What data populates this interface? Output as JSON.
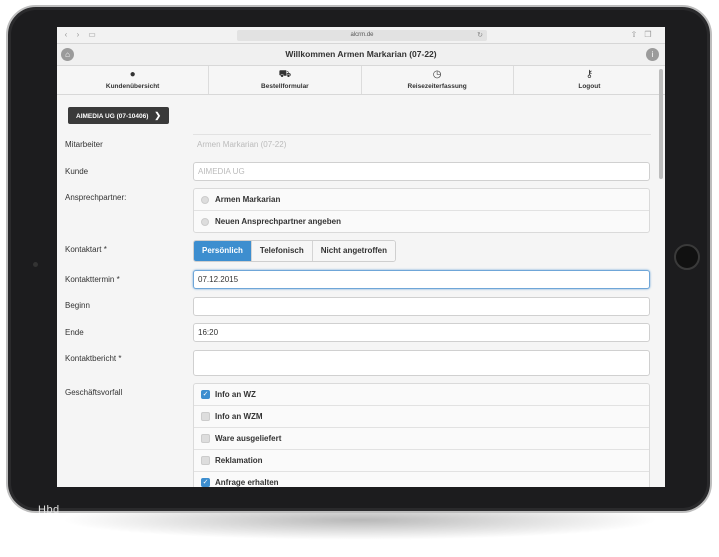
{
  "browser": {
    "url": "alcrm.de",
    "reload_icon": "reload-icon",
    "share_icon": "share-icon",
    "tabs_icon": "tabs-icon"
  },
  "header": {
    "title": "Willkommen Armen Markarian (07-22)",
    "home_icon": "home-icon",
    "info_icon": "info-icon"
  },
  "nav": {
    "items": [
      {
        "label": "Kundenübersicht",
        "icon": "user-icon"
      },
      {
        "label": "Bestellformular",
        "icon": "cart-icon"
      },
      {
        "label": "Reisezeiterfassung",
        "icon": "clock-icon"
      },
      {
        "label": "Logout",
        "icon": "key-icon"
      }
    ]
  },
  "company_button": {
    "label": "AIMEDIA UG (07-10406)"
  },
  "form": {
    "mitarbeiter": {
      "label": "Mitarbeiter",
      "value": "Armen Markarian (07-22)"
    },
    "kunde": {
      "label": "Kunde",
      "value": "AIMEDIA UG"
    },
    "ansprechpartner": {
      "label": "Ansprechpartner:",
      "options": [
        "Armen Markarian",
        "Neuen Ansprechpartner angeben"
      ]
    },
    "kontaktart": {
      "label": "Kontaktart *",
      "options": [
        "Persönlich",
        "Telefonisch",
        "Nicht angetroffen"
      ],
      "selected": "Persönlich"
    },
    "kontakttermin": {
      "label": "Kontakttermin *",
      "value": "07.12.2015"
    },
    "beginn": {
      "label": "Beginn",
      "value": ""
    },
    "ende": {
      "label": "Ende",
      "value": "16:20"
    },
    "kontaktbericht": {
      "label": "Kontaktbericht *",
      "value": ""
    },
    "geschaeftsvorfall": {
      "label": "Geschäftsvorfall",
      "options": [
        {
          "label": "Info an WZ",
          "checked": true
        },
        {
          "label": "Info an WZM",
          "checked": false
        },
        {
          "label": "Ware ausgeliefert",
          "checked": false
        },
        {
          "label": "Reklamation",
          "checked": false
        },
        {
          "label": "Anfrage erhalten",
          "checked": true
        }
      ]
    }
  },
  "colors": {
    "accent": "#3d8ecf",
    "dark_button": "#3a3a3a",
    "tablet_body": "#1c1c1e"
  },
  "watermark": "Hbd"
}
